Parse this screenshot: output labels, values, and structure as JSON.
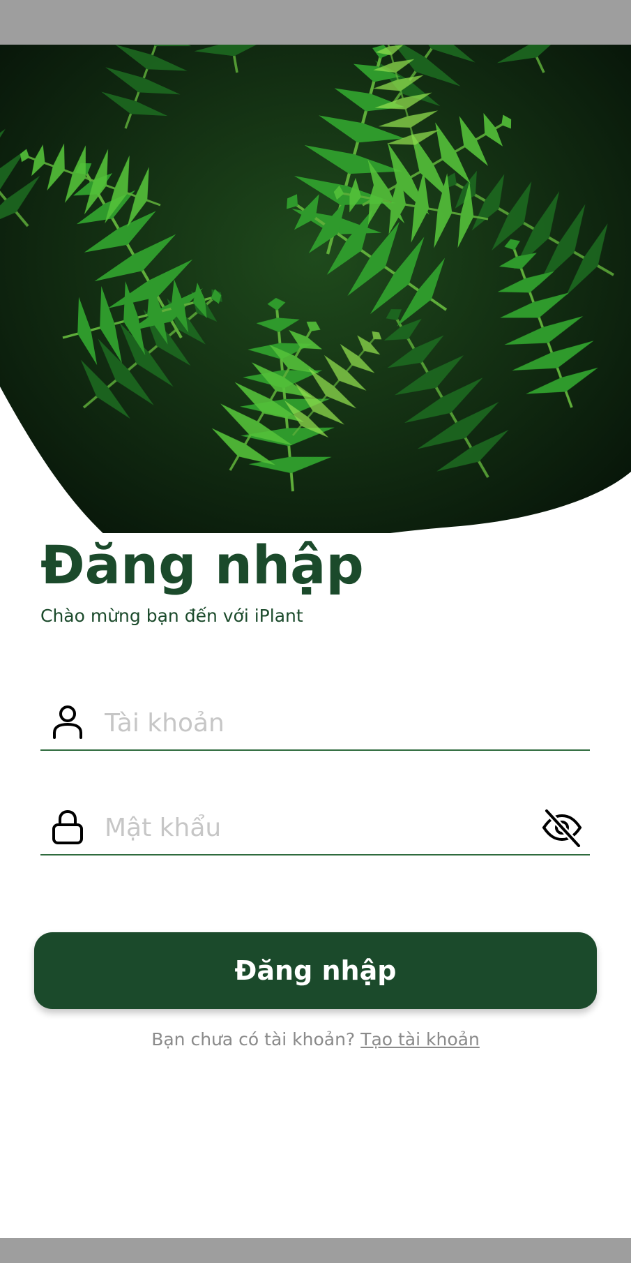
{
  "colors": {
    "primary": "#1b4a2b",
    "underline": "#2f6b3e",
    "placeholder": "#c6c6c6",
    "muted_text": "#8a8a8a",
    "system_bar": "#9e9e9e"
  },
  "hero": {
    "image_icon": "fern-leaves-image"
  },
  "login": {
    "title": "Đăng nhập",
    "subtitle": "Chào mừng bạn đến với iPlant"
  },
  "username_field": {
    "icon": "user-icon",
    "placeholder": "Tài khoản",
    "value": ""
  },
  "password_field": {
    "icon": "lock-icon",
    "toggle_icon": "eye-off-icon",
    "placeholder": "Mật khẩu",
    "value": ""
  },
  "login_button": {
    "label": "Đăng nhập"
  },
  "signup": {
    "prompt": "Bạn chưa có tài khoản?",
    "link_label": "Tạo tài khoản"
  }
}
